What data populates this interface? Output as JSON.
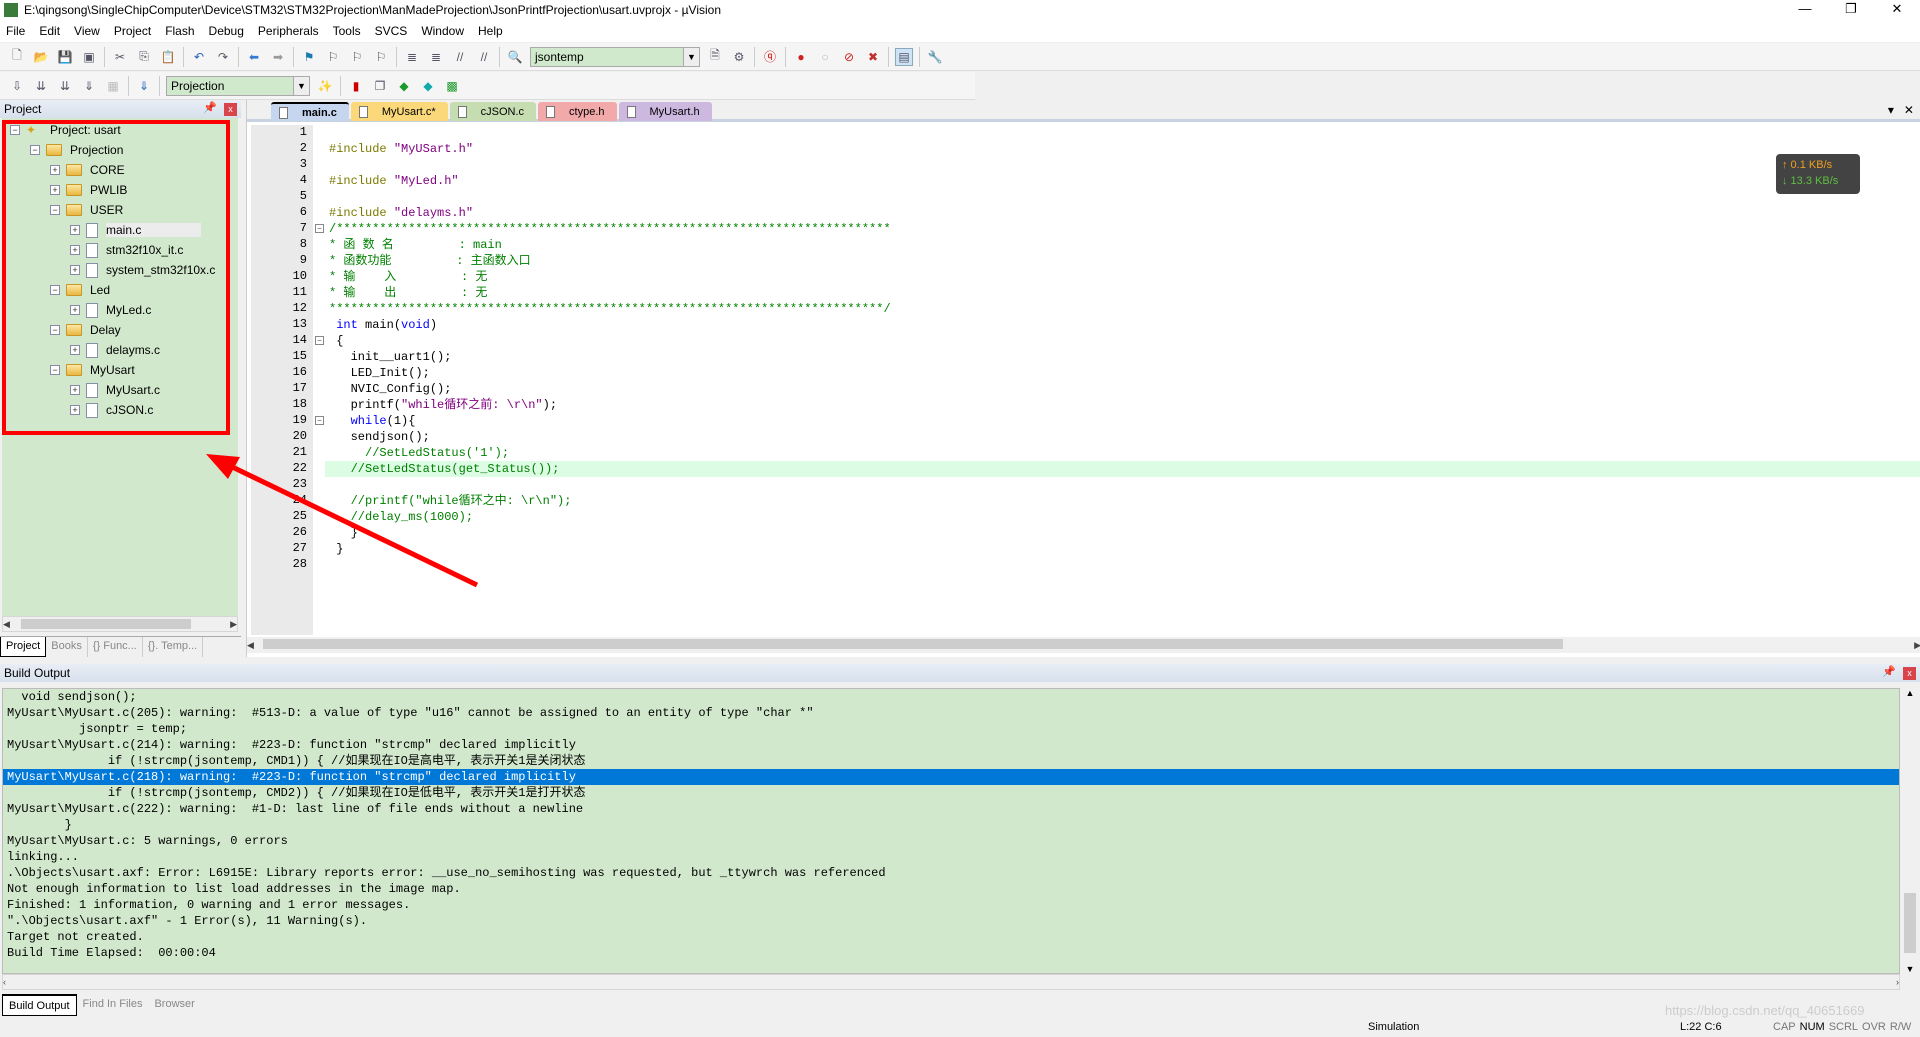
{
  "window": {
    "title": "E:\\qingsong\\SingleChipComputer\\Device\\STM32\\STM32Projection\\ManMadeProjection\\JsonPrintfProjection\\usart.uvprojx - µVision",
    "logo": "W5"
  },
  "menu": [
    "File",
    "Edit",
    "View",
    "Project",
    "Flash",
    "Debug",
    "Peripherals",
    "Tools",
    "SVCS",
    "Window",
    "Help"
  ],
  "toolbar": {
    "find_combo": "jsontemp",
    "target_combo": "Projection"
  },
  "project_panel": {
    "title": "Project",
    "tree": [
      {
        "label": "Project: usart",
        "level": 0,
        "type": "project",
        "expander": "−"
      },
      {
        "label": "Projection",
        "level": 1,
        "type": "folder",
        "expander": "−"
      },
      {
        "label": "CORE",
        "level": 2,
        "type": "folder",
        "expander": "+"
      },
      {
        "label": "PWLIB",
        "level": 2,
        "type": "folder",
        "expander": "+"
      },
      {
        "label": "USER",
        "level": 2,
        "type": "folder",
        "expander": "−"
      },
      {
        "label": "main.c",
        "level": 3,
        "type": "file",
        "expander": "+",
        "selected": true
      },
      {
        "label": "stm32f10x_it.c",
        "level": 3,
        "type": "file",
        "expander": "+"
      },
      {
        "label": "system_stm32f10x.c",
        "level": 3,
        "type": "file",
        "expander": "+"
      },
      {
        "label": "Led",
        "level": 2,
        "type": "folder",
        "expander": "−"
      },
      {
        "label": "MyLed.c",
        "level": 3,
        "type": "file",
        "expander": "+"
      },
      {
        "label": "Delay",
        "level": 2,
        "type": "folder",
        "expander": "−"
      },
      {
        "label": "delayms.c",
        "level": 3,
        "type": "file",
        "expander": "+"
      },
      {
        "label": "MyUsart",
        "level": 2,
        "type": "folder",
        "expander": "−"
      },
      {
        "label": "MyUsart.c",
        "level": 3,
        "type": "file",
        "expander": "+"
      },
      {
        "label": "cJSON.c",
        "level": 3,
        "type": "file",
        "expander": "+"
      }
    ],
    "tabs": [
      "Project",
      "Books",
      "{} Func...",
      "{}. Temp..."
    ]
  },
  "editor": {
    "tabs": [
      {
        "label": "main.c",
        "color": "#c7d6ef",
        "active": true
      },
      {
        "label": "MyUsart.c*",
        "color": "#fbd87a"
      },
      {
        "label": "cJSON.c",
        "color": "#c6dcb1"
      },
      {
        "label": "ctype.h",
        "color": "#f2a9a9"
      },
      {
        "label": "MyUsart.h",
        "color": "#cdb8e0"
      }
    ],
    "current_line": 22,
    "fold_lines": [
      7,
      14,
      19
    ],
    "lines": [
      [],
      [
        [
          "pp",
          "#include "
        ],
        [
          "st",
          "\"MyUSart.h\""
        ]
      ],
      [],
      [
        [
          "pp",
          "#include "
        ],
        [
          "st",
          "\"MyLed.h\""
        ]
      ],
      [],
      [
        [
          "pp",
          "#include "
        ],
        [
          "st",
          "\"delayms.h\""
        ]
      ],
      [
        [
          "cm",
          "/*****************************************************************************"
        ]
      ],
      [
        [
          "cm",
          "* 函 数 名         : main"
        ]
      ],
      [
        [
          "cm",
          "* 函数功能         : 主函数入口"
        ]
      ],
      [
        [
          "cm",
          "* 输    入         : 无"
        ]
      ],
      [
        [
          "cm",
          "* 输    出         : 无"
        ]
      ],
      [
        [
          "cm",
          "*****************************************************************************/"
        ]
      ],
      [
        [
          "nm",
          " "
        ],
        [
          "kw",
          "int"
        ],
        [
          "nm",
          " main("
        ],
        [
          "kw",
          "void"
        ],
        [
          "nm",
          ")"
        ]
      ],
      [
        [
          "nm",
          " {"
        ]
      ],
      [
        [
          "nm",
          "   init__uart1();"
        ]
      ],
      [
        [
          "nm",
          "   LED_Init();"
        ]
      ],
      [
        [
          "nm",
          "   NVIC_Config();"
        ]
      ],
      [
        [
          "nm",
          "   printf("
        ],
        [
          "st",
          "\"while循环之前: \\r\\n\""
        ],
        [
          "nm",
          ");"
        ]
      ],
      [
        [
          "nm",
          "   "
        ],
        [
          "kw",
          "while"
        ],
        [
          "nm",
          "(1){"
        ]
      ],
      [
        [
          "nm",
          "   sendjson();"
        ]
      ],
      [
        [
          "cm",
          "     //SetLedStatus('1');"
        ]
      ],
      [
        [
          "cm",
          "   //SetLedStatus(get_Status());"
        ]
      ],
      [],
      [
        [
          "cm",
          "   //printf(\"while循环之中: \\r\\n\");"
        ]
      ],
      [
        [
          "cm",
          "   //delay_ms(1000);"
        ]
      ],
      [
        [
          "nm",
          "   }"
        ]
      ],
      [
        [
          "nm",
          " }"
        ]
      ],
      []
    ]
  },
  "net_speed": {
    "up": "↑ 0.1 KB/s",
    "down": "↓ 13.3 KB/s"
  },
  "build_output": {
    "title": "Build Output",
    "selected_index": 5,
    "lines": [
      "  void sendjson();",
      "MyUsart\\MyUsart.c(205): warning:  #513-D: a value of type \"u16\" cannot be assigned to an entity of type \"char *\"",
      "          jsonptr = temp;",
      "MyUsart\\MyUsart.c(214): warning:  #223-D: function \"strcmp\" declared implicitly",
      "              if (!strcmp(jsontemp, CMD1)) { //如果现在IO是高电平, 表示开关1是关闭状态",
      "MyUsart\\MyUsart.c(218): warning:  #223-D: function \"strcmp\" declared implicitly",
      "              if (!strcmp(jsontemp, CMD2)) { //如果现在IO是低电平, 表示开关1是打开状态",
      "MyUsart\\MyUsart.c(222): warning:  #1-D: last line of file ends without a newline",
      "        }",
      "MyUsart\\MyUsart.c: 5 warnings, 0 errors",
      "linking...",
      ".\\Objects\\usart.axf: Error: L6915E: Library reports error: __use_no_semihosting was requested, but _ttywrch was referenced",
      "Not enough information to list load addresses in the image map.",
      "Finished: 1 information, 0 warning and 1 error messages.",
      "\".\\Objects\\usart.axf\" - 1 Error(s), 11 Warning(s).",
      "Target not created.",
      "Build Time Elapsed:  00:00:04"
    ],
    "tabs": [
      "Build Output",
      "Find In Files",
      "Browser"
    ]
  },
  "status": {
    "mode": "Simulation",
    "position": "L:22 C:6",
    "indicators": [
      "CAP",
      "NUM",
      "SCRL",
      "OVR",
      "R/W"
    ],
    "watermark": "https://blog.csdn.net/qq_40651669"
  }
}
